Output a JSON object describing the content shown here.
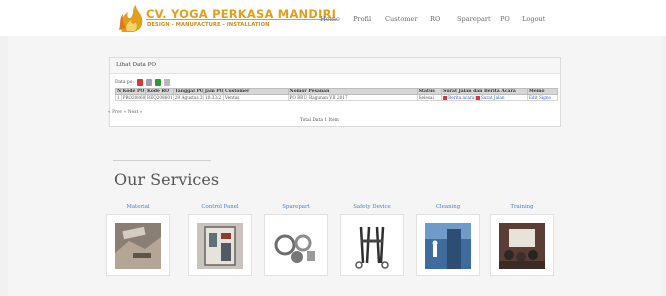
{
  "brand": {
    "name": "CV. YOGA PERKASA MANDIRI",
    "tagline": "DESIGN - MANUFACTURE - INSTALLATION"
  },
  "nav": [
    {
      "label": "Home"
    },
    {
      "label": "Profil"
    },
    {
      "label": "Customer"
    },
    {
      "label": "RO"
    },
    {
      "label": "Sparepart"
    },
    {
      "label": "PO"
    },
    {
      "label": "Logout"
    }
  ],
  "panel": {
    "title": "Lihat Data PO",
    "data_po_label": "Data po:"
  },
  "table": {
    "headers": [
      "No",
      "Kode PO",
      "Kode RO",
      "Tanggal PO",
      "Jam PO",
      "Customer",
      "Nomor Pesanan",
      "Status",
      "Surat Jalan dan Berita Acara",
      "Memo"
    ],
    "rows": [
      {
        "no": "1",
        "kode_po": "PRO2086011",
        "kode_ro": "REQ2086011",
        "tanggal": "29 Agustus 2017",
        "jam": "10:33:2",
        "customer": "Ventus",
        "nomor": "PO BRU_Ragunan VII 2017",
        "status": "Selesai",
        "berita": "Berita acara",
        "sep": "|",
        "surat": "Surat Jalan",
        "memo": "Edit Signo"
      }
    ]
  },
  "pager": "« Prev « Next »",
  "total": "Total Data 1 Item",
  "services": {
    "title": "Our Services",
    "items": [
      {
        "label": "Material",
        "icon": "material-photo"
      },
      {
        "label": "Control Panel",
        "icon": "control-panel-photo"
      },
      {
        "label": "Sparepart",
        "icon": "sparepart-photo"
      },
      {
        "label": "Safety Device",
        "icon": "safety-device-photo"
      },
      {
        "label": "Cleaning",
        "icon": "cleaning-photo"
      },
      {
        "label": "Training",
        "icon": "training-photo"
      }
    ]
  },
  "colors": {
    "brand": "#e2a01a",
    "link": "#4f7cc1",
    "band": "#f1f1f1"
  }
}
